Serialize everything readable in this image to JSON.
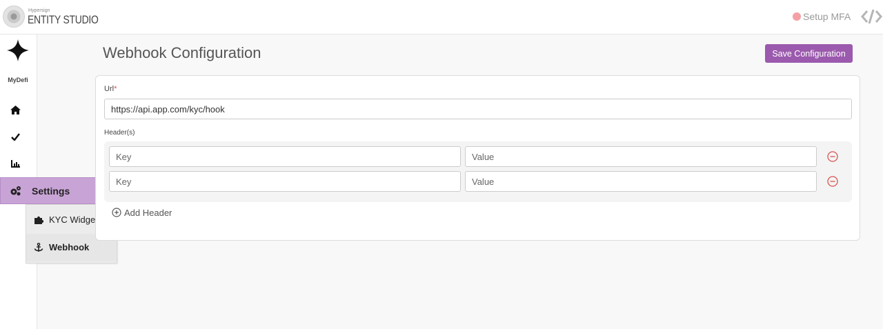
{
  "topbar": {
    "brand_small": "Hypersign",
    "brand_name": "ENTITY STUDIO",
    "mfa_label": "Setup MFA"
  },
  "sidebar": {
    "org_name": "MyDefi",
    "items": [
      {
        "icon": "home-icon"
      },
      {
        "icon": "check-icon"
      },
      {
        "icon": "chart-icon"
      }
    ]
  },
  "settings_menu": {
    "label": "Settings",
    "items": [
      {
        "label": "KYC Widget",
        "icon": "puzzle-icon"
      },
      {
        "label": "Webhook",
        "icon": "anchor-icon"
      }
    ]
  },
  "main": {
    "title": "Webhook Configuration",
    "save_label": "Save Configuration",
    "url_label": "Url",
    "url_required_mark": "*",
    "url_value": "https://api.app.com/kyc/hook",
    "headers_label": "Header(s)",
    "header_rows": [
      {
        "key_placeholder": "Key",
        "value_placeholder": "Value"
      },
      {
        "key_placeholder": "Key",
        "value_placeholder": "Value"
      }
    ],
    "add_header_label": "Add Header"
  },
  "colors": {
    "accent": "#9b5aad",
    "menu_active": "#c8a4d6",
    "danger": "#d9534f"
  }
}
